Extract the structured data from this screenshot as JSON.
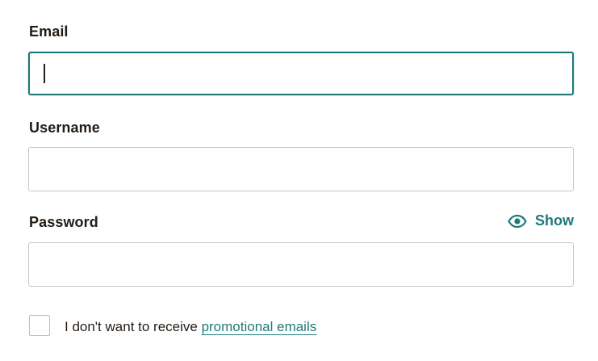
{
  "form": {
    "email": {
      "label": "Email",
      "value": "",
      "placeholder": ""
    },
    "username": {
      "label": "Username",
      "value": "",
      "placeholder": ""
    },
    "password": {
      "label": "Password",
      "value": "",
      "placeholder": "",
      "show_label": "Show",
      "show_icon": "eye-icon"
    },
    "consent": {
      "text": "I don't want to receive ",
      "link_text": "promotional emails",
      "checked": false
    }
  },
  "colors": {
    "accent": "#1f7a7a",
    "text": "#241c15",
    "border": "#c6c6c6"
  }
}
